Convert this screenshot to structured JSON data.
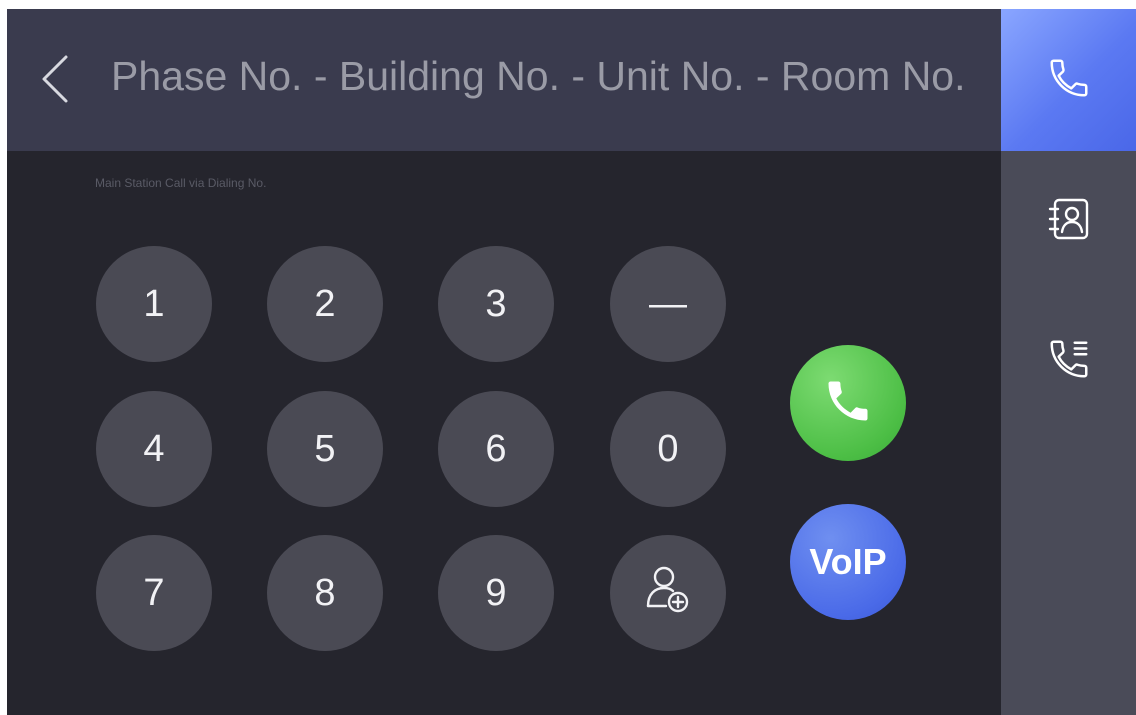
{
  "header": {
    "title": "Phase No. - Building No. - Unit No. - Room No."
  },
  "subtitle": "Main Station Call via Dialing No.",
  "keypad": {
    "keys": [
      "1",
      "2",
      "3",
      "—",
      "4",
      "5",
      "6",
      "0",
      "7",
      "8",
      "9"
    ]
  },
  "actions": {
    "voip_label": "VoIP"
  },
  "icons": {
    "back": "chevron-left-icon",
    "add_contact": "add-user-icon",
    "call": "phone-icon",
    "sidebar_call": "phone-icon",
    "sidebar_contacts": "contacts-icon",
    "sidebar_log": "call-log-icon"
  },
  "colors": {
    "screen_bg": "#25252d",
    "header_bg": "#3a3b4e",
    "key_bg": "#4a4a54",
    "call_green": "#4cbe45",
    "voip_blue": "#4a6ae8",
    "sidebar_bg": "#4a4b58",
    "sidebar_active": "#5b79f2"
  }
}
